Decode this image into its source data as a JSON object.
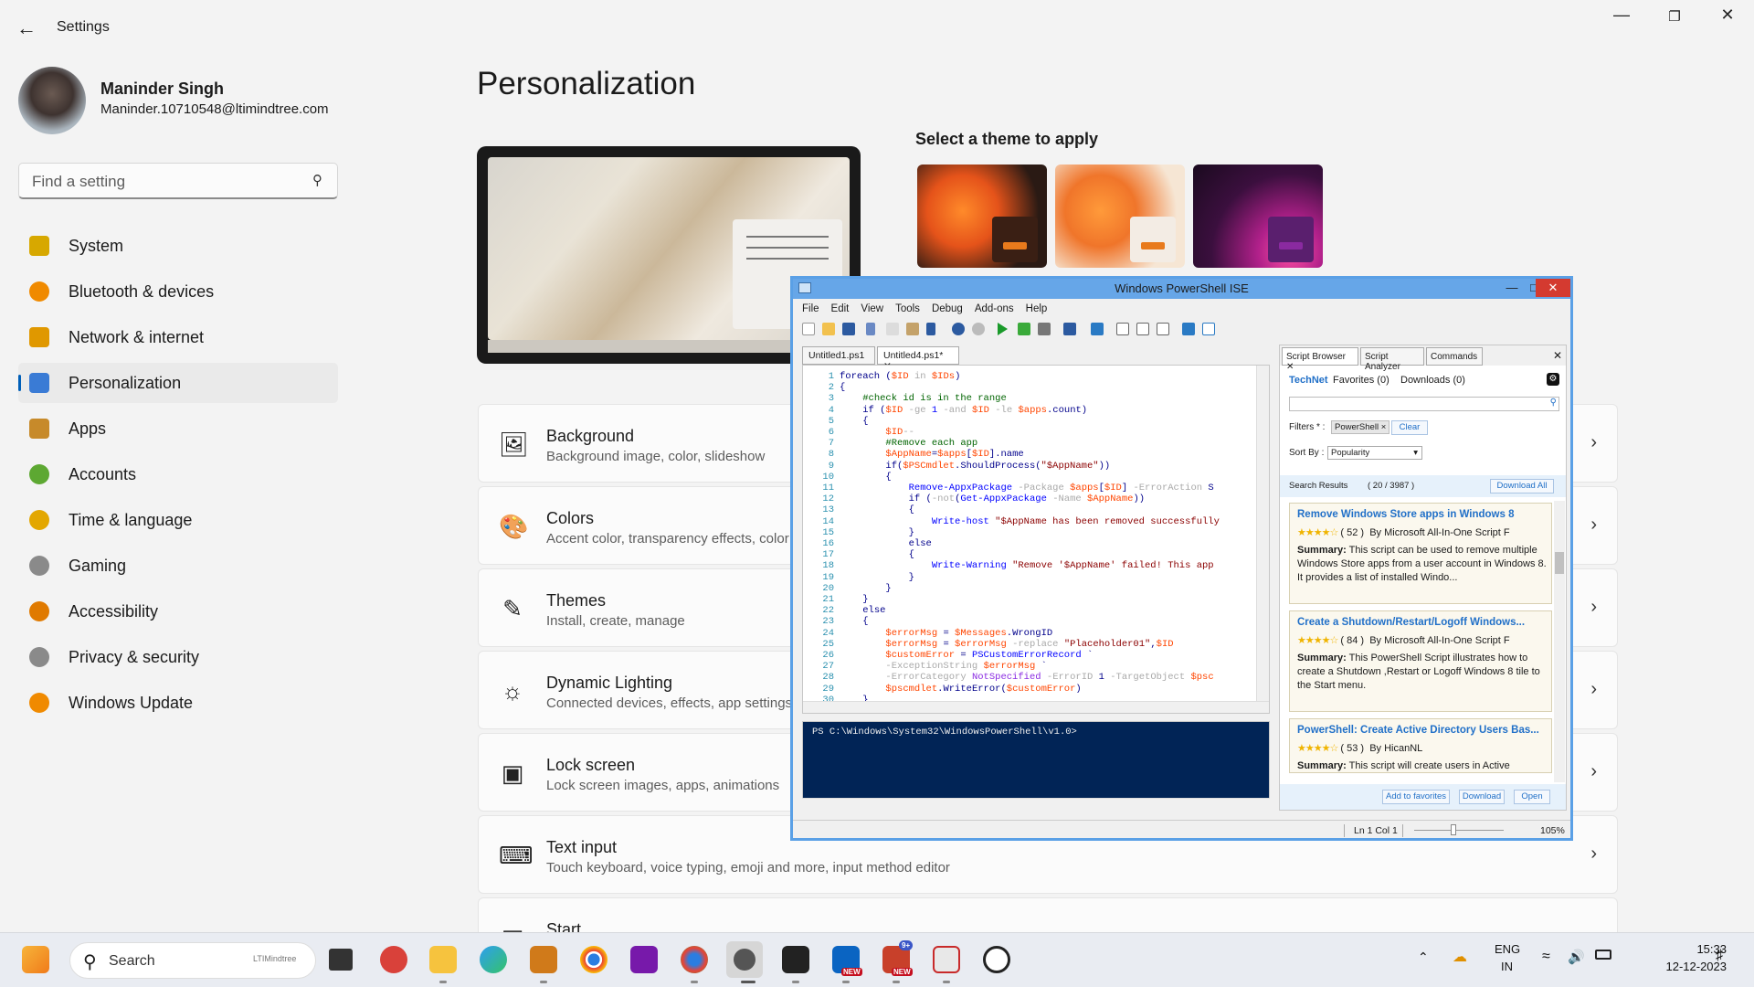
{
  "settings": {
    "app_name": "Settings",
    "user": {
      "name": "Maninder Singh",
      "email": "Maninder.10710548@ltimindtree.com"
    },
    "search_placeholder": "Find a setting",
    "nav": [
      {
        "label": "System",
        "icon": "monitor-icon",
        "color": "#d7a800"
      },
      {
        "label": "Bluetooth & devices",
        "icon": "bluetooth-icon",
        "color": "#f08a00"
      },
      {
        "label": "Network & internet",
        "icon": "wifi-icon",
        "color": "#e09800"
      },
      {
        "label": "Personalization",
        "icon": "paintbrush-icon",
        "color": "#3a7bd5"
      },
      {
        "label": "Apps",
        "icon": "apps-icon",
        "color": "#c78a2a"
      },
      {
        "label": "Accounts",
        "icon": "person-icon",
        "color": "#5da832"
      },
      {
        "label": "Time & language",
        "icon": "clock-globe-icon",
        "color": "#e3a700"
      },
      {
        "label": "Gaming",
        "icon": "gamepad-icon",
        "color": "#8a8a8a"
      },
      {
        "label": "Accessibility",
        "icon": "accessibility-icon",
        "color": "#e07a00"
      },
      {
        "label": "Privacy & security",
        "icon": "shield-icon",
        "color": "#8a8a8a"
      },
      {
        "label": "Windows Update",
        "icon": "update-icon",
        "color": "#f08a00"
      }
    ],
    "active_nav": "Personalization",
    "page_title": "Personalization",
    "select_theme": "Select a theme to apply",
    "cards": [
      {
        "title": "Background",
        "subtitle": "Background image, color, slideshow",
        "icon": "image-icon"
      },
      {
        "title": "Colors",
        "subtitle": "Accent color, transparency effects, color theme",
        "icon": "palette-icon"
      },
      {
        "title": "Themes",
        "subtitle": "Install, create, manage",
        "icon": "pen-icon"
      },
      {
        "title": "Dynamic Lighting",
        "subtitle": "Connected devices, effects, app settings",
        "icon": "lighting-icon"
      },
      {
        "title": "Lock screen",
        "subtitle": "Lock screen images, apps, animations",
        "icon": "lock-screen-icon"
      },
      {
        "title": "Text input",
        "subtitle": "Touch keyboard, voice typing, emoji and more, input method editor",
        "icon": "keyboard-icon"
      },
      {
        "title": "Start",
        "subtitle": "",
        "icon": "start-icon"
      }
    ]
  },
  "ise": {
    "title": "Windows PowerShell ISE",
    "menu": [
      "File",
      "Edit",
      "View",
      "Tools",
      "Debug",
      "Add-ons",
      "Help"
    ],
    "tabs": [
      "Untitled1.ps1",
      "Untitled4.ps1*"
    ],
    "console_prompt": "PS C:\\Windows\\System32\\WindowsPowerShell\\v1.0>",
    "status": {
      "position": "Ln 1  Col 1",
      "zoom": "105%"
    },
    "script_browser": {
      "tabs": [
        "Script Browser",
        "Script Analyzer",
        "Commands"
      ],
      "sources": [
        "TechNet",
        "Favorites (0)",
        "Downloads (0)"
      ],
      "filters_label": "Filters * :",
      "filter_chip": "PowerShell",
      "clear": "Clear",
      "sort_label": "Sort By :",
      "sort_value": "Popularity",
      "results_label": "Search Results",
      "results_count": "( 20 / 3987 )",
      "download_all": "Download All",
      "results": [
        {
          "title": "Remove Windows Store apps in Windows 8",
          "rating": "( 52 )",
          "by": "By",
          "author": "Microsoft All-In-One Script F",
          "summary_label": "Summary:",
          "summary": "This script can be used to remove multiple Windows Store apps from a user account in Windows 8. It provides a list of installed Windo..."
        },
        {
          "title": "Create a Shutdown/Restart/Logoff Windows...",
          "rating": "( 84 )",
          "by": "By",
          "author": "Microsoft All-In-One Script F",
          "summary_label": "Summary:",
          "summary": "This PowerShell Script illustrates how to create a Shutdown ,Restart or Logoff Windows 8 tile to the Start menu."
        },
        {
          "title": "PowerShell: Create Active Directory Users Bas...",
          "rating": "( 53 )",
          "by": "By",
          "author": "HicanNL",
          "summary_label": "Summary:",
          "summary": "This script will create users in Active"
        }
      ],
      "actions": [
        "Add to favorites",
        "Download",
        "Open"
      ]
    }
  },
  "taskbar": {
    "search": "Search",
    "search_logo": "LTIMindtree",
    "badge_new": "NEW",
    "badge_count": "9+",
    "lang": "ENG",
    "region": "IN",
    "time": "15:33",
    "date": "12-12-2023"
  }
}
